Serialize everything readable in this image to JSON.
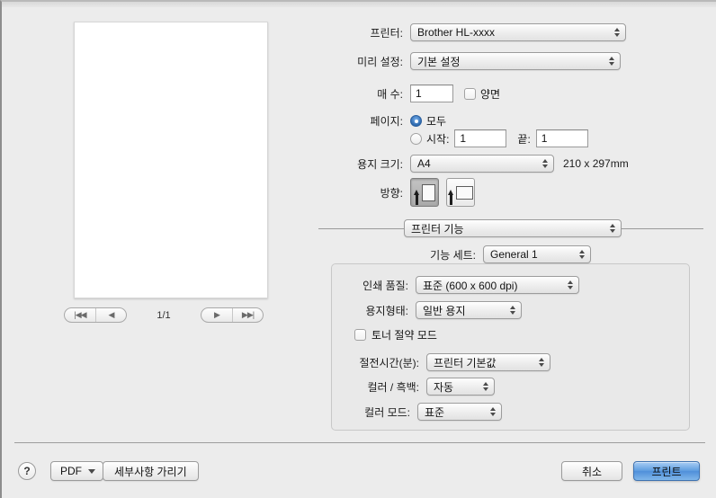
{
  "preview": {
    "page_indicator": "1/1",
    "nav": {
      "first_label": "|◀◀",
      "prev_label": "◀",
      "next_label": "▶",
      "last_label": "▶▶|"
    }
  },
  "settings": {
    "printer_label": "프린터:",
    "printer_value": "Brother HL-xxxx",
    "preset_label": "미리 설정:",
    "preset_value": "기본 설정",
    "copies_label": "매 수:",
    "copies_value": "1",
    "duplex_label": "양면",
    "duplex_checked": false,
    "pages_label": "페이지:",
    "pages_all_label": "모두",
    "pages_all_selected": true,
    "pages_from_label": "시작:",
    "pages_from_value": "1",
    "pages_to_label": "끝:",
    "pages_to_value": "1",
    "paper_size_label": "용지 크기:",
    "paper_size_value": "A4",
    "paper_dimensions": "210 x 297mm",
    "orientation_label": "방향:",
    "orientation_selected": "portrait"
  },
  "features": {
    "section_popup_value": "프린터 기능",
    "feature_set_label": "기능 세트:",
    "feature_set_value": "General 1",
    "print_quality_label": "인쇄 품질:",
    "print_quality_value": "표준 (600 x 600 dpi)",
    "media_type_label": "용지형태:",
    "media_type_value": "일반 용지",
    "toner_save_label": "토너 절약 모드",
    "toner_save_checked": false,
    "sleep_time_label": "절전시간(분):",
    "sleep_time_value": "프린터 기본값",
    "color_mono_label": "컬러 / 흑백:",
    "color_mono_value": "자동",
    "color_mode_label": "컬러 모드:",
    "color_mode_value": "표준"
  },
  "bottom_bar": {
    "help_label": "?",
    "pdf_label": "PDF",
    "hide_details_label": "세부사항 가리기",
    "cancel_label": "취소",
    "print_label": "프린트"
  },
  "colors": {
    "window_bg": "#ececec",
    "default_button_blue": "#5f9ee0",
    "radio_blue": "#2c68ad",
    "text": "#1c1c1c"
  }
}
